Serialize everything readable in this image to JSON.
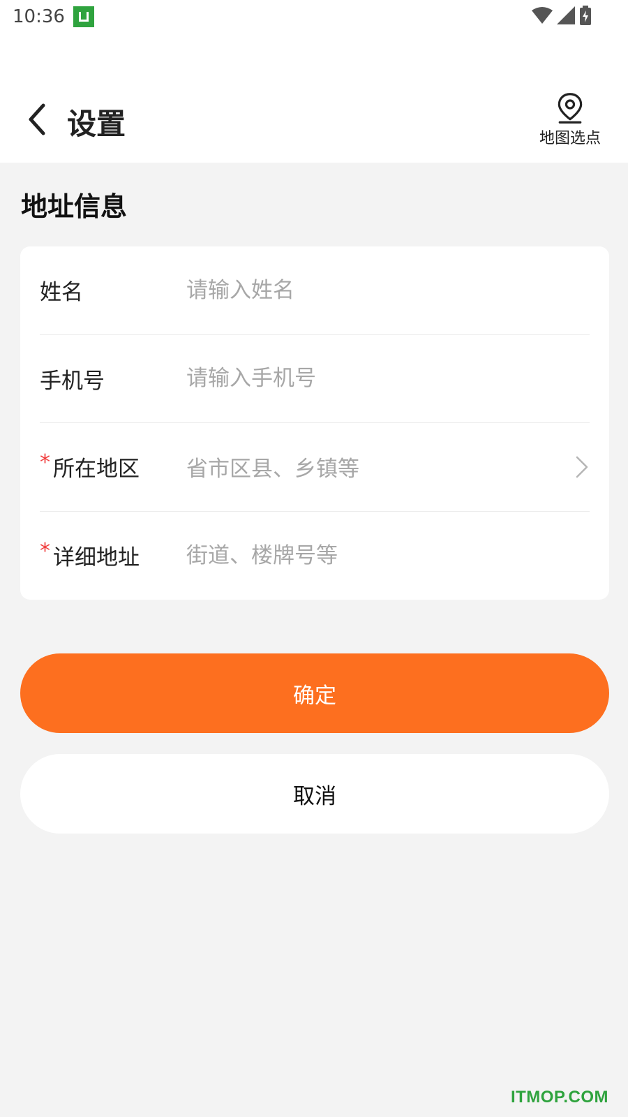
{
  "status_bar": {
    "time": "10:36",
    "notification_icon": "app-notification-icon",
    "icons": [
      "wifi-icon",
      "signal-icon",
      "battery-charging-icon"
    ]
  },
  "header": {
    "title": "设置",
    "back_icon": "chevron-left-icon",
    "map_pick": {
      "icon": "location-pin-icon",
      "label": "地图选点"
    }
  },
  "section": {
    "title": "地址信息"
  },
  "form": {
    "fields": [
      {
        "label": "姓名",
        "placeholder": "请输入姓名",
        "value": "",
        "required": false
      },
      {
        "label": "手机号",
        "placeholder": "请输入手机号",
        "value": "",
        "required": false
      },
      {
        "label": "所在地区",
        "placeholder": "省市区县、乡镇等",
        "required": true,
        "required_mark": "*",
        "icon": "chevron-right-icon"
      },
      {
        "label": "详细地址",
        "placeholder": "街道、楼牌号等",
        "value": "",
        "required": true,
        "required_mark": "*"
      }
    ]
  },
  "actions": {
    "confirm_label": "确定",
    "cancel_label": "取消"
  },
  "colors": {
    "accent": "#fd6f1f",
    "required": "#f03c3c",
    "background": "#f3f3f3",
    "watermark": "#2fa33e"
  },
  "watermark": "ITMOP.COM"
}
